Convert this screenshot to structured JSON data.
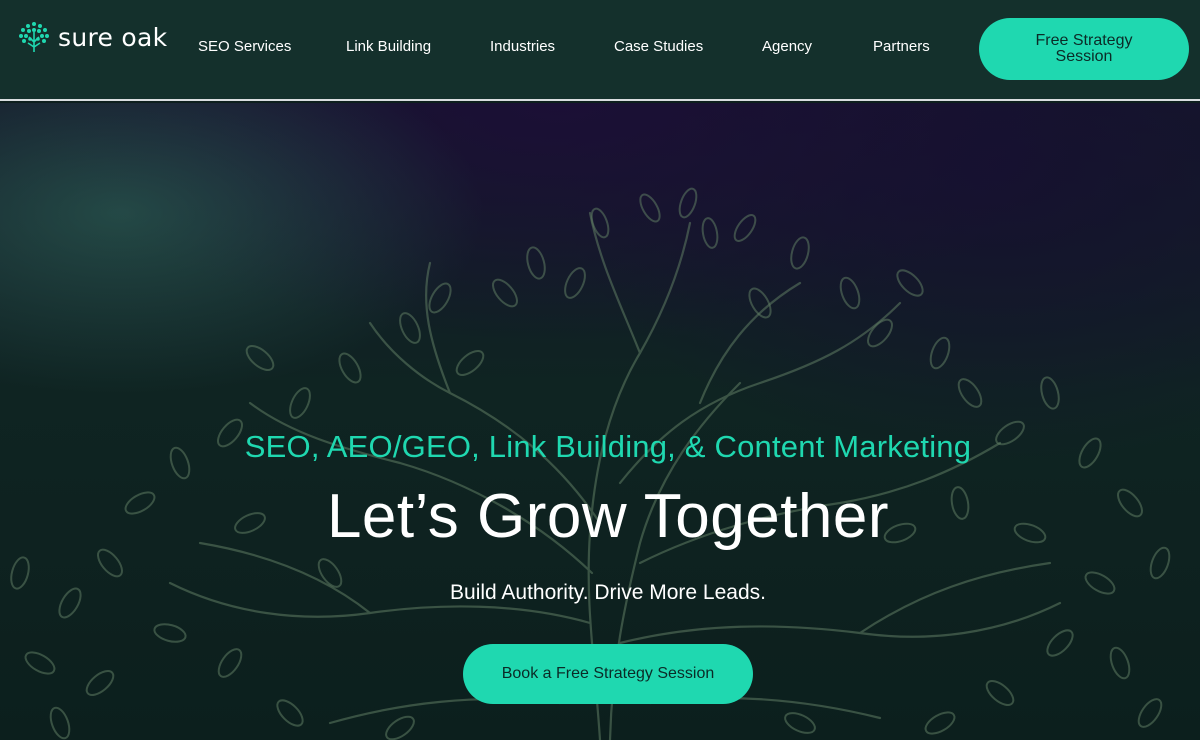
{
  "brand": {
    "name": "sure oak",
    "accent": "#1fd8b0",
    "header_bg": "#14302c"
  },
  "nav": {
    "items": [
      {
        "label": "SEO Services"
      },
      {
        "label": "Link Building"
      },
      {
        "label": "Industries"
      },
      {
        "label": "Case Studies"
      },
      {
        "label": "Agency"
      },
      {
        "label": "Partners"
      }
    ],
    "cta_label": "Free Strategy Session"
  },
  "hero": {
    "eyebrow": "SEO, AEO/GEO, Link Building, & Content Marketing",
    "headline": "Let’s Grow Together",
    "subline": "Build Authority. Drive More Leads.",
    "cta_label": "Book a Free Strategy Session"
  },
  "icons": {
    "logo": "tree-logo-icon",
    "background": "tree-illustration"
  }
}
